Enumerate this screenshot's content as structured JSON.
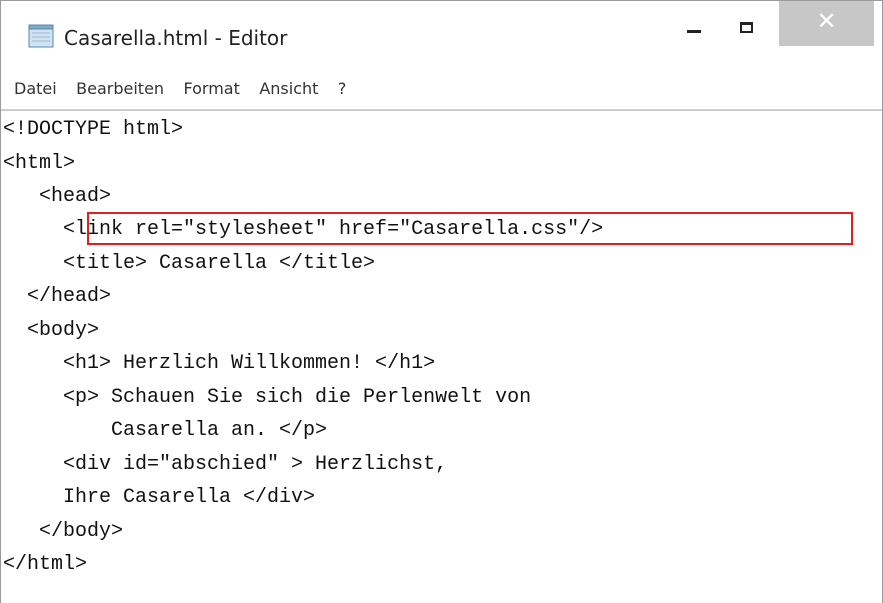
{
  "window": {
    "title": "Casarella.html - Editor",
    "icon": "notepad-icon",
    "controls": {
      "minimize": "minimize-icon",
      "maximize": "maximize-icon",
      "close": "close-icon",
      "close_glyph": "✕"
    }
  },
  "menu": [
    "Datei",
    "Bearbeiten",
    "Format",
    "Ansicht",
    "?"
  ],
  "editor": {
    "lines": [
      "<!DOCTYPE html>",
      "<html>",
      "   <head>",
      "     <link rel=\"stylesheet\" href=\"Casarella.css\"/>",
      "     <title> Casarella </title>",
      "  </head>",
      "  <body>",
      "     <h1> Herzlich Willkommen! </h1>",
      "     <p> Schauen Sie sich die Perlenwelt von",
      "         Casarella an. </p>",
      "     <div id=\"abschied\" > Herzlichst,",
      "     Ihre Casarella </div>",
      "   </body>",
      "</html>"
    ],
    "highlight_color": "#e02020"
  }
}
